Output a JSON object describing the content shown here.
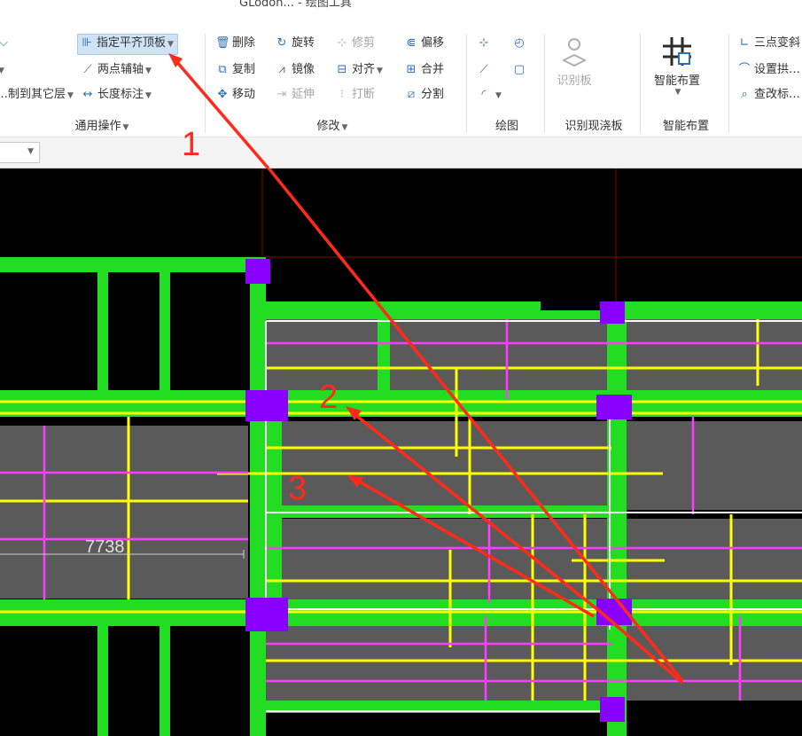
{
  "window": {
    "title": "GLodon... - 绘图工具"
  },
  "ribbon": {
    "general_ops": {
      "items": [
        "指定平齐顶板",
        "两点辅轴",
        "长度标注"
      ],
      "partial_items": [
        "…制到其它层"
      ],
      "label": "通用操作"
    },
    "modify": {
      "items": [
        "删除",
        "旋转",
        "修剪",
        "偏移",
        "复制",
        "镜像",
        "对齐",
        "合并",
        "移动",
        "延伸",
        "打断",
        "分割"
      ],
      "label": "修改"
    },
    "draw": {
      "label": "绘图"
    },
    "recognize": {
      "button": "识别板",
      "label": "识别现浇板"
    },
    "smart_layout": {
      "button": "智能布置",
      "label": "智能布置"
    },
    "right_items": [
      "三点变斜",
      "设置拱…",
      "查改标…"
    ]
  },
  "drawing": {
    "dimension_text": "7738",
    "annotations": [
      "1",
      "2",
      "3"
    ],
    "colors": {
      "background": "#000000",
      "beam": "#22dd22",
      "slab": "#5a5a5a",
      "column": "#8a00ff",
      "rebar_yellow": "#ffff00",
      "rebar_magenta": "#ff3cff",
      "outline": "#ffffff",
      "annotation": "#ff2a1a",
      "axis": "#8b0000"
    }
  }
}
